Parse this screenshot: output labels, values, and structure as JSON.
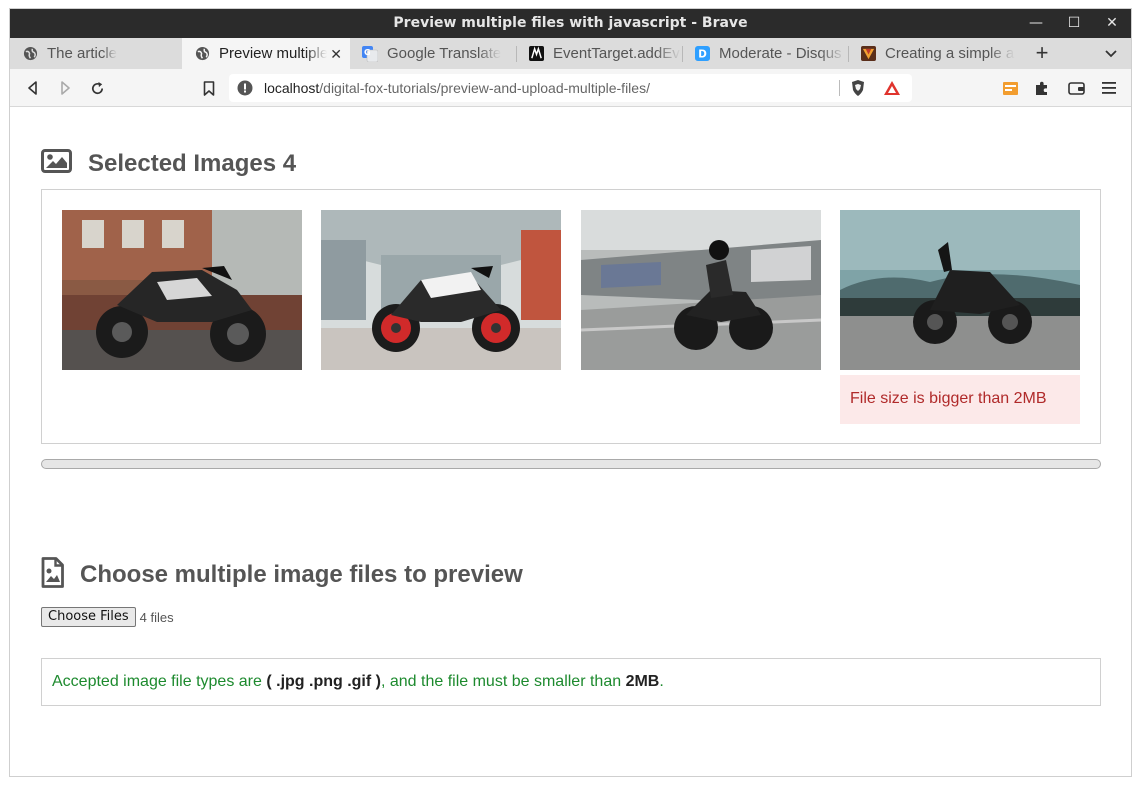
{
  "window": {
    "title": "Preview multiple files with javascript - Brave"
  },
  "window_controls": {
    "minimize": "—",
    "maximize": "☐",
    "close": "✕"
  },
  "tabs": [
    {
      "label": "The article",
      "icon": "globe-icon"
    },
    {
      "label": "Preview multiple files with javascript",
      "icon": "globe-icon",
      "active": true,
      "close": "✕"
    },
    {
      "label": "Google Translate",
      "icon": "google-translate-icon"
    },
    {
      "label": "EventTarget.addEventListener",
      "icon": "mdn-icon"
    },
    {
      "label": "Moderate - Disqus",
      "icon": "disqus-icon"
    },
    {
      "label": "Creating a simple app",
      "icon": "site-favicon-icon"
    }
  ],
  "new_tab": "+",
  "address": {
    "host": "localhost",
    "path": "/digital-fox-tutorials/preview-and-upload-multiple-files/"
  },
  "gallery": {
    "heading": "Selected Images 4",
    "images": [
      {
        "alt": "motorcycle-1",
        "icon": "image-icon"
      },
      {
        "alt": "motorcycle-2",
        "icon": "image-icon"
      },
      {
        "alt": "motorcycle-3",
        "icon": "image-icon"
      },
      {
        "alt": "motorcycle-4",
        "icon": "image-icon"
      }
    ],
    "error_message": "File size is bigger than 2MB"
  },
  "upload": {
    "heading": "Choose multiple image files to preview",
    "button_label": "Choose Files",
    "status": "4 files"
  },
  "note": {
    "part1": "Accepted image file types are ",
    "types": "( .jpg .png .gif )",
    "part2": ", and the file must be smaller than ",
    "size": "2MB",
    "part3": "."
  },
  "colors": {
    "titlebar": "#2b2b2b",
    "error_bg": "#fce9e9",
    "error_text": "#b02a2a",
    "note_text": "#1d8a2e"
  }
}
